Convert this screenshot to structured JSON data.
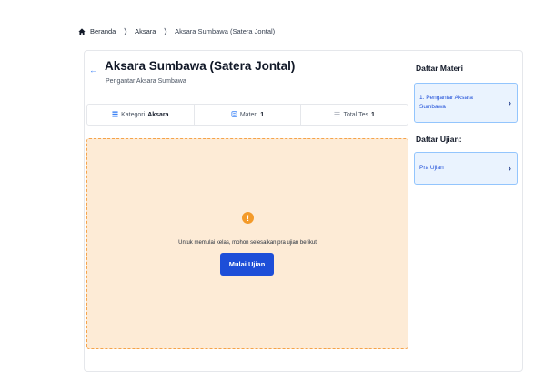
{
  "breadcrumb": {
    "home": "Beranda",
    "section": "Aksara",
    "current": "Aksara Sumbawa (Satera Jontal)",
    "separator": "❭"
  },
  "header": {
    "back_icon": "←",
    "title": "Aksara Sumbawa (Satera Jontal)",
    "subtitle": "Pengantar Aksara Sumbawa"
  },
  "info": {
    "category_label": "Kategori",
    "category_value": "Aksara",
    "materi_label": "Materi",
    "materi_value": "1",
    "tes_label": "Total Tes",
    "tes_value": "1"
  },
  "notice": {
    "icon": "!",
    "text": "Untuk memulai kelas, mohon selesaikan pra ujian berikut",
    "button_label": "Mulai Ujian"
  },
  "sidebar": {
    "materi_heading": "Daftar Materi",
    "materi_items": [
      {
        "label": "1. Pengantar Aksara Sumbawa"
      }
    ],
    "ujian_heading": "Daftar Ujian:",
    "ujian_items": [
      {
        "label": "Pra Ujian"
      }
    ],
    "chevron": "›"
  },
  "colors": {
    "accent": "#1d4ed8",
    "notice_bg": "#fdebd6",
    "warning": "#f39a2a"
  }
}
